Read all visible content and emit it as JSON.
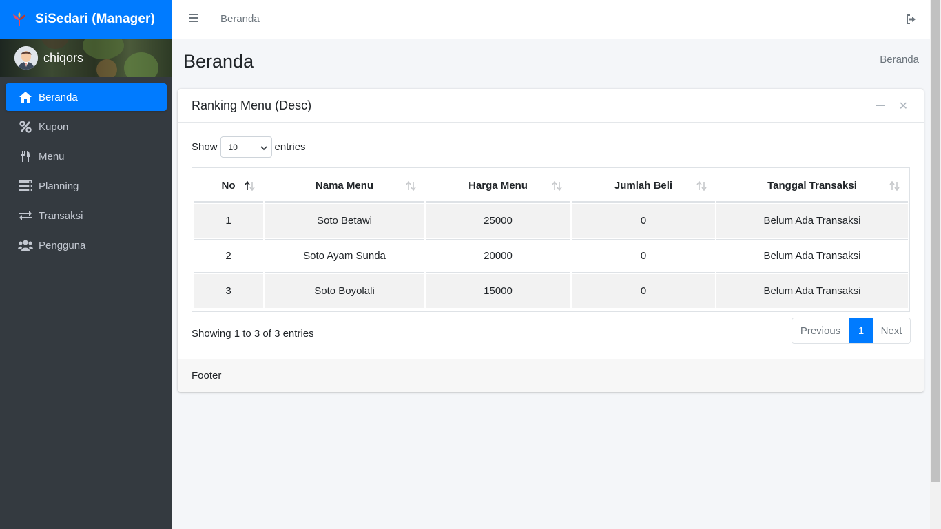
{
  "brand": {
    "title": "SiSedari (Manager)",
    "logo_icon": "tree-logo-icon"
  },
  "user": {
    "name": "chiqors"
  },
  "sidebar": {
    "items": [
      {
        "label": "Beranda",
        "icon": "home-icon",
        "active": true
      },
      {
        "label": "Kupon",
        "icon": "percent-icon",
        "active": false
      },
      {
        "label": "Menu",
        "icon": "utensils-icon",
        "active": false
      },
      {
        "label": "Planning",
        "icon": "server-icon",
        "active": false
      },
      {
        "label": "Transaksi",
        "icon": "exchange-icon",
        "active": false
      },
      {
        "label": "Pengguna",
        "icon": "users-icon",
        "active": false
      }
    ]
  },
  "topbar": {
    "home_link": "Beranda"
  },
  "page": {
    "title": "Beranda",
    "breadcrumb": "Beranda"
  },
  "card": {
    "title": "Ranking Menu (Desc)",
    "length": {
      "show": "Show",
      "value": "10",
      "entries": "entries"
    },
    "table": {
      "headers": [
        "No",
        "Nama Menu",
        "Harga Menu",
        "Jumlah Beli",
        "Tanggal Transaksi"
      ],
      "rows": [
        [
          "1",
          "Soto Betawi",
          "25000",
          "0",
          "Belum Ada Transaksi"
        ],
        [
          "2",
          "Soto Ayam Sunda",
          "20000",
          "0",
          "Belum Ada Transaksi"
        ],
        [
          "3",
          "Soto Boyolali",
          "15000",
          "0",
          "Belum Ada Transaksi"
        ]
      ]
    },
    "info": "Showing 1 to 3 of 3 entries",
    "pagination": {
      "previous": "Previous",
      "current": "1",
      "next": "Next"
    },
    "footer": "Footer"
  },
  "colors": {
    "primary": "#007bff",
    "sidebar": "#343a40",
    "background": "#f4f6f9"
  }
}
